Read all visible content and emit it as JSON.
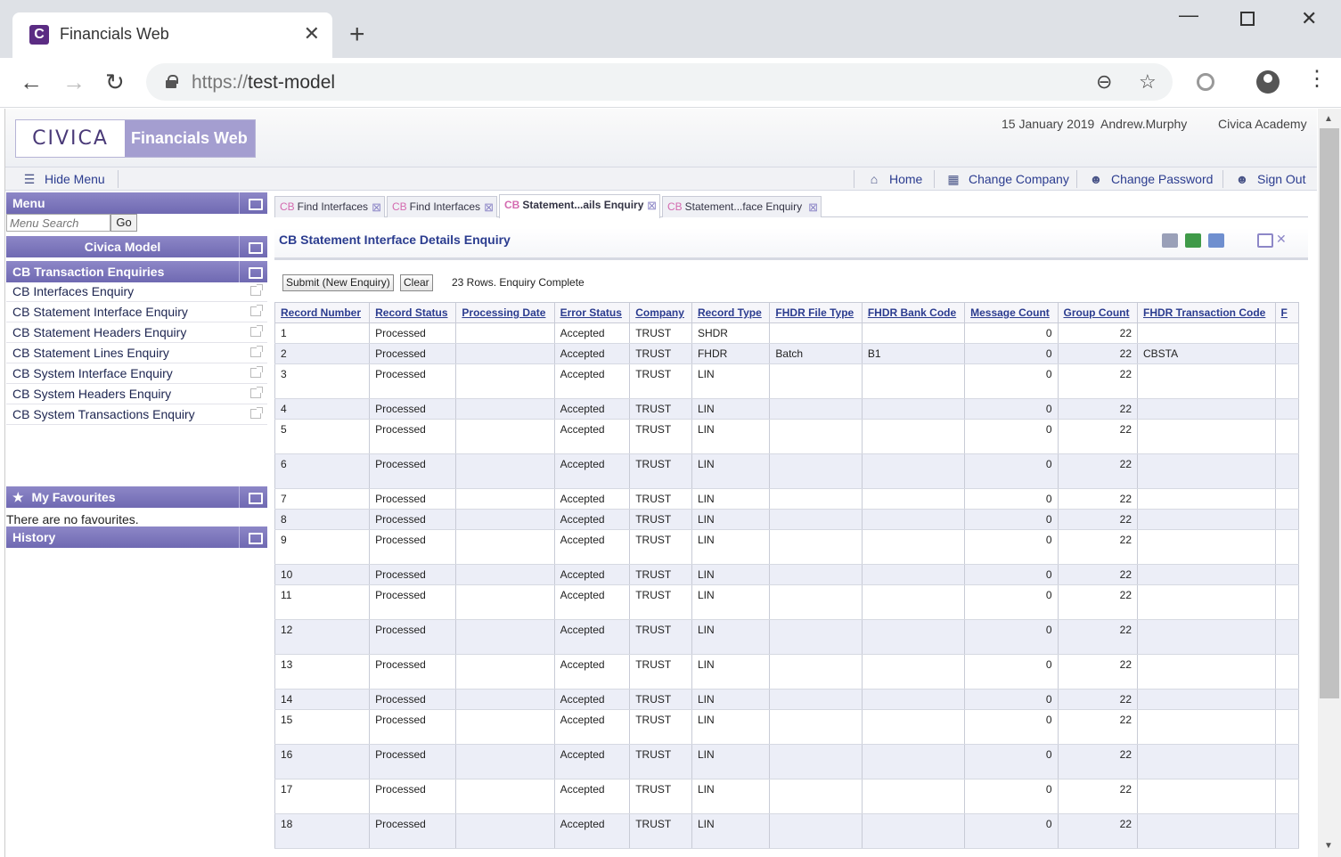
{
  "browser": {
    "tab_title": "Financials Web",
    "favicon_letter": "C",
    "new_tab": "+",
    "close_tab": "✕",
    "url_scheme": "https://",
    "url_host": "test-model"
  },
  "app": {
    "logo_civica": "CIVICA",
    "logo_product": "Financials Web",
    "date": "15 January 2019",
    "user": "Andrew.Murphy",
    "organisation": "Civica Academy",
    "toolbar": {
      "hide_menu": "Hide Menu",
      "home": "Home",
      "change_company": "Change Company",
      "change_password": "Change Password",
      "sign_out": "Sign Out"
    }
  },
  "menu": {
    "title": "Menu",
    "search_placeholder": "Menu Search",
    "go": "Go",
    "model": "Civica Model",
    "section": "CB Transaction Enquiries",
    "items": [
      "CB Interfaces Enquiry",
      "CB Statement Interface Enquiry",
      "CB Statement Headers Enquiry",
      "CB Statement Lines Enquiry",
      "CB System Interface Enquiry",
      "CB System Headers Enquiry",
      "CB System Transactions Enquiry"
    ],
    "favourites_title": "My Favourites",
    "favourites_empty": "There are no favourites.",
    "history_title": "History"
  },
  "content": {
    "tabs": [
      {
        "prefix": "CB",
        "label": "Find Interfaces",
        "active": false
      },
      {
        "prefix": "CB",
        "label": "Find Interfaces",
        "active": false
      },
      {
        "prefix": "CB",
        "label": "Statement...ails Enquiry",
        "active": true
      },
      {
        "prefix": "CB",
        "label": "Statement...face Enquiry",
        "active": false
      }
    ],
    "title": "CB Statement Interface Details Enquiry",
    "submit": "Submit (New Enquiry)",
    "clear": "Clear",
    "status": "23 Rows. Enquiry Complete",
    "columns": [
      "Record Number",
      "Record Status",
      "Processing Date",
      "Error Status",
      "Company",
      "Record Type",
      "FHDR File Type",
      "FHDR Bank Code",
      "Message Count",
      "Group Count",
      "FHDR Transaction Code",
      "F"
    ],
    "rows": [
      [
        "1",
        "Processed",
        "",
        "Accepted",
        "TRUST",
        "SHDR",
        "",
        "",
        "0",
        "22",
        ""
      ],
      [
        "2",
        "Processed",
        "",
        "Accepted",
        "TRUST",
        "FHDR",
        "Batch",
        "B1",
        "0",
        "22",
        "CBSTA"
      ],
      [
        "3",
        "Processed",
        "",
        "Accepted",
        "TRUST",
        "LIN",
        "",
        "",
        "0",
        "22",
        ""
      ],
      [
        "4",
        "Processed",
        "",
        "Accepted",
        "TRUST",
        "LIN",
        "",
        "",
        "0",
        "22",
        ""
      ],
      [
        "5",
        "Processed",
        "",
        "Accepted",
        "TRUST",
        "LIN",
        "",
        "",
        "0",
        "22",
        ""
      ],
      [
        "6",
        "Processed",
        "",
        "Accepted",
        "TRUST",
        "LIN",
        "",
        "",
        "0",
        "22",
        ""
      ],
      [
        "7",
        "Processed",
        "",
        "Accepted",
        "TRUST",
        "LIN",
        "",
        "",
        "0",
        "22",
        ""
      ],
      [
        "8",
        "Processed",
        "",
        "Accepted",
        "TRUST",
        "LIN",
        "",
        "",
        "0",
        "22",
        ""
      ],
      [
        "9",
        "Processed",
        "",
        "Accepted",
        "TRUST",
        "LIN",
        "",
        "",
        "0",
        "22",
        ""
      ],
      [
        "10",
        "Processed",
        "",
        "Accepted",
        "TRUST",
        "LIN",
        "",
        "",
        "0",
        "22",
        ""
      ],
      [
        "11",
        "Processed",
        "",
        "Accepted",
        "TRUST",
        "LIN",
        "",
        "",
        "0",
        "22",
        ""
      ],
      [
        "12",
        "Processed",
        "",
        "Accepted",
        "TRUST",
        "LIN",
        "",
        "",
        "0",
        "22",
        ""
      ],
      [
        "13",
        "Processed",
        "",
        "Accepted",
        "TRUST",
        "LIN",
        "",
        "",
        "0",
        "22",
        ""
      ],
      [
        "14",
        "Processed",
        "",
        "Accepted",
        "TRUST",
        "LIN",
        "",
        "",
        "0",
        "22",
        ""
      ],
      [
        "15",
        "Processed",
        "",
        "Accepted",
        "TRUST",
        "LIN",
        "",
        "",
        "0",
        "22",
        ""
      ],
      [
        "16",
        "Processed",
        "",
        "Accepted",
        "TRUST",
        "LIN",
        "",
        "",
        "0",
        "22",
        ""
      ],
      [
        "17",
        "Processed",
        "",
        "Accepted",
        "TRUST",
        "LIN",
        "",
        "",
        "0",
        "22",
        ""
      ],
      [
        "18",
        "Processed",
        "",
        "Accepted",
        "TRUST",
        "LIN",
        "",
        "",
        "0",
        "22",
        ""
      ]
    ]
  },
  "colors": {
    "brand_purple": "#5b2c83",
    "panel_header": "#7a74ba",
    "link_blue": "#2b3c8f",
    "row_alt": "#eceef7",
    "tab_prefix_pink": "#d46bb0"
  }
}
